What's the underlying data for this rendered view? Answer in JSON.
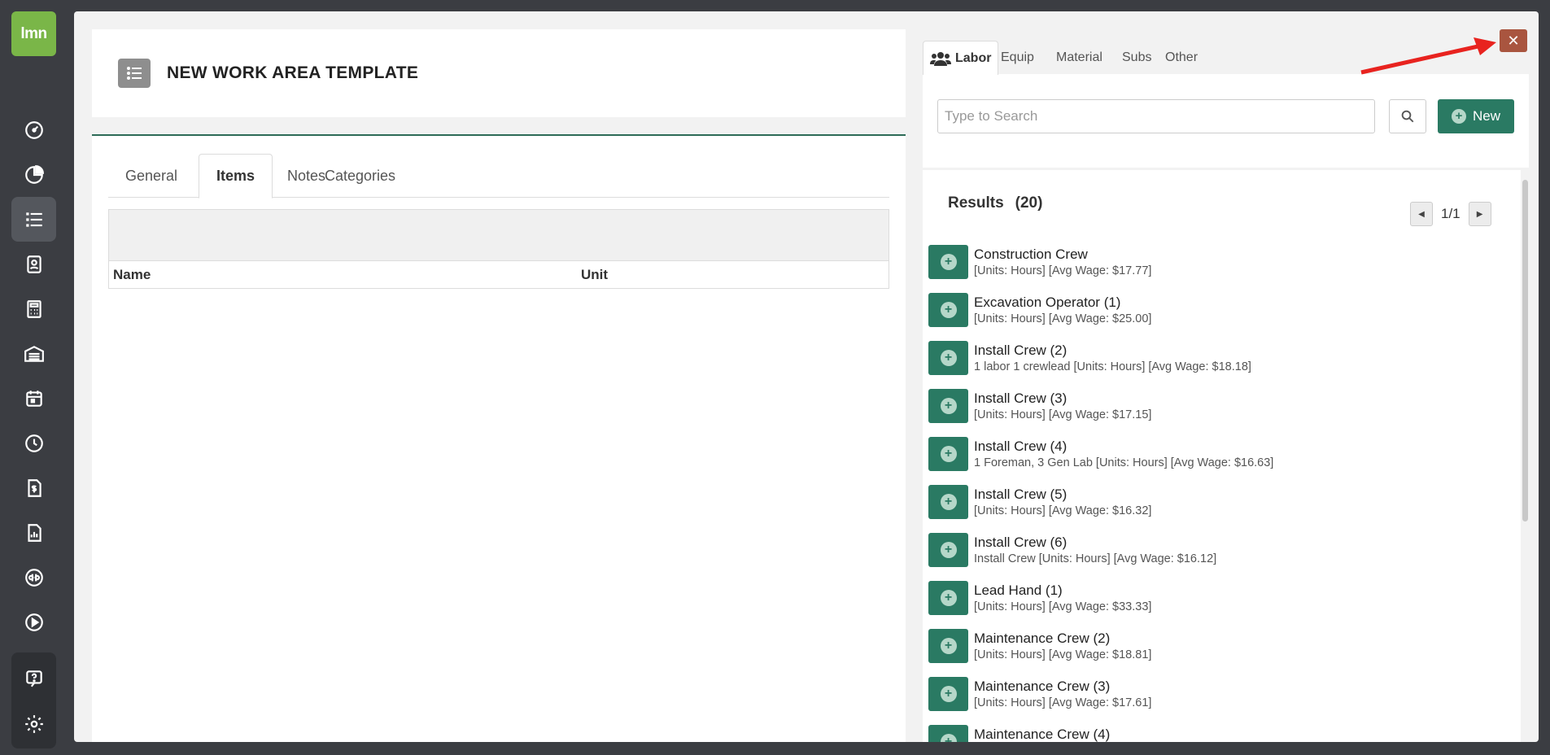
{
  "app": {
    "logo_text": "lmn"
  },
  "sidebar": {
    "items": [
      {
        "icon": "dashboard-icon"
      },
      {
        "icon": "pie-chart-icon"
      },
      {
        "icon": "list-icon",
        "active": true
      },
      {
        "icon": "contact-card-icon"
      },
      {
        "icon": "calculator-icon"
      },
      {
        "icon": "warehouse-icon"
      },
      {
        "icon": "calendar-icon"
      },
      {
        "icon": "clock-icon"
      },
      {
        "icon": "invoice-icon"
      },
      {
        "icon": "report-icon"
      },
      {
        "icon": "quickbooks-icon"
      },
      {
        "icon": "play-icon"
      }
    ],
    "bottom": [
      {
        "icon": "help-icon"
      },
      {
        "icon": "gear-icon"
      }
    ]
  },
  "header": {
    "title": "NEW WORK AREA TEMPLATE"
  },
  "tabs": [
    {
      "label": "General"
    },
    {
      "label": "Items",
      "active": true
    },
    {
      "label": "Notes"
    },
    {
      "label": "Categories"
    }
  ],
  "table": {
    "columns": {
      "name": "Name",
      "unit": "Unit"
    }
  },
  "right_tabs": [
    {
      "label": "Labor",
      "active": true
    },
    {
      "label": "Equip"
    },
    {
      "label": "Material"
    },
    {
      "label": "Subs"
    },
    {
      "label": "Other"
    }
  ],
  "search": {
    "placeholder": "Type to Search",
    "new_label": "New"
  },
  "results": {
    "label": "Results",
    "count": "(20)",
    "page": "1/1",
    "items": [
      {
        "name": "Construction Crew",
        "desc": "[Units: Hours] [Avg Wage: $17.77]"
      },
      {
        "name": "Excavation Operator (1)",
        "desc": "[Units: Hours] [Avg Wage: $25.00]"
      },
      {
        "name": "Install Crew (2)",
        "desc": "1 labor 1 crewlead [Units: Hours] [Avg Wage: $18.18]"
      },
      {
        "name": "Install Crew (3)",
        "desc": "[Units: Hours] [Avg Wage: $17.15]"
      },
      {
        "name": "Install Crew (4)",
        "desc": "1 Foreman, 3 Gen Lab [Units: Hours] [Avg Wage: $16.63]"
      },
      {
        "name": "Install Crew (5)",
        "desc": "[Units: Hours] [Avg Wage: $16.32]"
      },
      {
        "name": "Install Crew (6)",
        "desc": "Install Crew [Units: Hours] [Avg Wage: $16.12]"
      },
      {
        "name": "Lead Hand (1)",
        "desc": "[Units: Hours] [Avg Wage: $33.33]"
      },
      {
        "name": "Maintenance Crew (2)",
        "desc": "[Units: Hours] [Avg Wage: $18.81]"
      },
      {
        "name": "Maintenance Crew (3)",
        "desc": "[Units: Hours] [Avg Wage: $17.61]"
      },
      {
        "name": "Maintenance Crew (4)",
        "desc": ""
      }
    ]
  },
  "colors": {
    "brand_green": "#7ab648",
    "action_green": "#2a7a63",
    "close_red": "#a9553f",
    "annotation_arrow": "#e8231f"
  }
}
